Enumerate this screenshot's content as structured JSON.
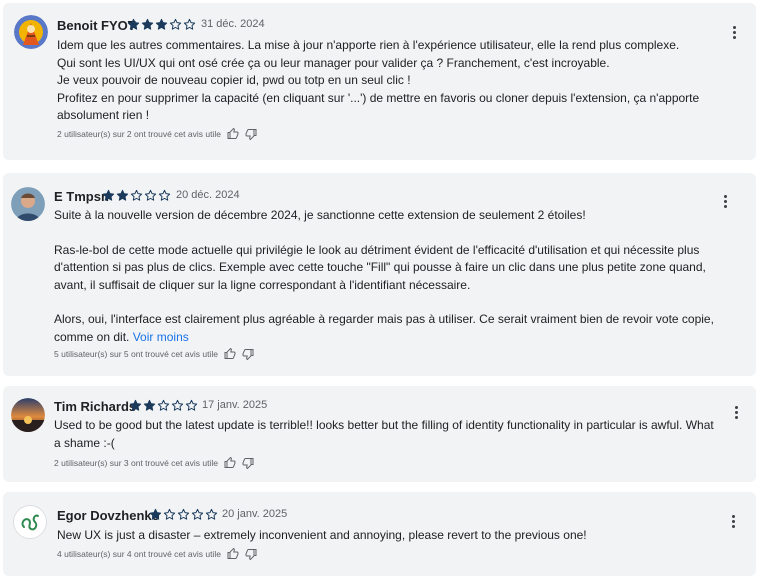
{
  "reviews": [
    {
      "name": "Benoit FYOT",
      "rating": 3,
      "date": "31 déc. 2024",
      "avatar_icon": "cartoon-avatar-icon",
      "lines": [
        "Idem que les autres commentaires. La mise à jour n'apporte rien à l'expérience utilisateur, elle la rend plus complexe.",
        "Qui sont les UI/UX qui ont osé crée ça ou leur manager pour valider ça ? Franchement, c'est incroyable.",
        "Je veux pouvoir de nouveau copier id, pwd ou totp en un seul clic !",
        "Profitez en pour supprimer la capacité (en cliquant sur '...') de mettre en favoris ou cloner depuis l'extension, ça n'apporte",
        "absolument rien !"
      ],
      "helpful": "2 utilisateur(s) sur 2 ont trouvé cet avis utile"
    },
    {
      "name": "E Tmpsn",
      "rating": 2,
      "date": "20 déc. 2024",
      "avatar_icon": "photo-avatar-icon",
      "lines": [
        "Suite à la nouvelle version de décembre 2024, je sanctionne cette extension de seulement 2 étoiles!",
        "",
        "Ras-le-bol de cette mode actuelle qui privilégie le look au détriment évident de l'efficacité d'utilisation et qui nécessite plus",
        "d'attention si pas plus de clics. Exemple avec cette touche \"Fill\" qui pousse à faire un clic dans une plus petite zone quand,",
        "avant, il suffisait de cliquer sur la ligne correspondant à l'identifiant nécessaire.",
        "",
        "Alors, oui, l'interface est clairement plus agréable à regarder mais pas à utiliser. Ce serait vraiment bien de revoir vote copie,",
        "comme on dit."
      ],
      "more_label": "Voir moins",
      "helpful": "5 utilisateur(s) sur 5 ont trouvé cet avis utile"
    },
    {
      "name": "Tim Richards",
      "rating": 2,
      "date": "17 janv. 2025",
      "avatar_icon": "sunset-avatar-icon",
      "lines": [
        "Used to be good but the latest update is terrible!! looks better but the filling of identity functionality in particular is awful. What",
        "a shame :-("
      ],
      "helpful": "2 utilisateur(s) sur 3 ont trouvé cet avis utile"
    },
    {
      "name": "Egor Dovzhenko",
      "rating": 1,
      "date": "20 janv. 2025",
      "avatar_icon": "squiggle-avatar-icon",
      "lines": [
        "New UX is just a disaster – extremely inconvenient and annoying, please revert to the previous one!"
      ],
      "helpful": "4 utilisateur(s) sur 4 ont trouvé cet avis utile"
    }
  ],
  "max_rating": 5,
  "star_color": "#1b3a5c"
}
